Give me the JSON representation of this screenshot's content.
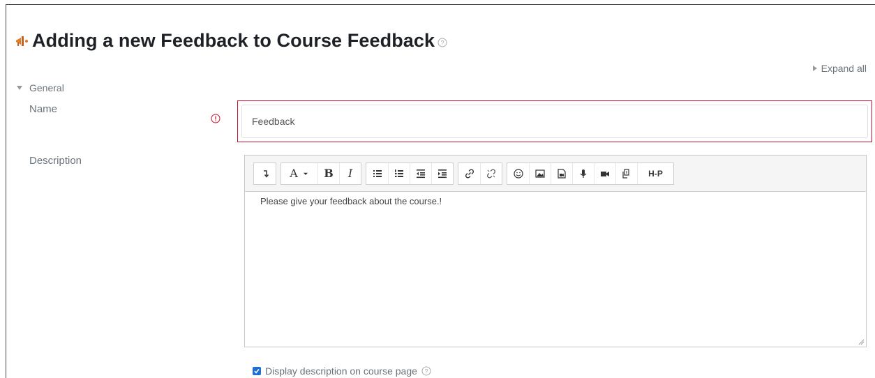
{
  "page": {
    "title": "Adding a new Feedback to Course Feedback",
    "title_icon": "feedback-megaphone-icon",
    "accent_color": "#1f6fd1",
    "required_color": "#c8102e"
  },
  "expand_all": {
    "label": "Expand all"
  },
  "general_section": {
    "label": "General"
  },
  "name_field": {
    "label": "Name",
    "value": "Feedback"
  },
  "description_field": {
    "label": "Description",
    "content": "Please give your feedback about the course.!",
    "toolbar": {
      "groups": [
        [
          "collapse-toggle-icon"
        ],
        [
          "font-style-icon",
          "bold-icon",
          "italic-icon"
        ],
        [
          "bullet-list-icon",
          "numbered-list-icon",
          "outdent-icon",
          "indent-icon"
        ],
        [
          "link-icon",
          "unlink-icon"
        ],
        [
          "emoticon-icon",
          "image-icon",
          "media-icon",
          "record-audio-icon",
          "record-video-icon",
          "manage-files-icon",
          "h5p-icon"
        ]
      ],
      "font_label": "A",
      "bold_label": "B",
      "italic_label": "I",
      "h5p_label": "H-P"
    }
  },
  "display_description": {
    "label": "Display description on course page",
    "checked": true
  }
}
